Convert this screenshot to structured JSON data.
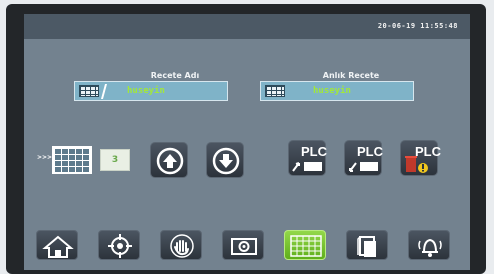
{
  "header": {
    "datetime": "20-06-19 11:55:48"
  },
  "recipe_name": {
    "label": "Recete Adı",
    "value": "huseyin"
  },
  "current_recipe": {
    "label": "Anlık Recete",
    "value": "huseyin"
  },
  "recipe_controls": {
    "arrows": ">>>",
    "index_value": "3"
  },
  "plc_buttons": {
    "label": "PLC"
  },
  "bottom_nav": {
    "items": [
      {
        "name": "home-icon"
      },
      {
        "name": "crosshair-icon"
      },
      {
        "name": "hand-icon"
      },
      {
        "name": "camera-icon"
      },
      {
        "name": "recipe-grid-icon",
        "active": true
      },
      {
        "name": "document-icon"
      },
      {
        "name": "alarm-bell-icon"
      }
    ]
  },
  "colors": {
    "screen_bg": "#73828f",
    "field_bg": "#7fb3c8",
    "field_text": "#a2e83a",
    "active_button": "#7fca33"
  }
}
